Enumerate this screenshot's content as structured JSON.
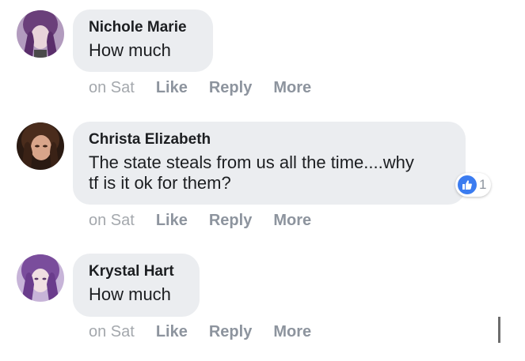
{
  "comments": [
    {
      "author": "Nichole Marie",
      "text": "How much",
      "time": "on Sat",
      "like_label": "Like",
      "reply_label": "Reply",
      "more_label": "More"
    },
    {
      "author": "Christa Elizabeth",
      "text": "The state steals from us all the time....why\ntf is it ok for them?",
      "time": "on Sat",
      "like_label": "Like",
      "reply_label": "Reply",
      "more_label": "More",
      "reactions": {
        "icon": "thumbs-up-icon",
        "count": "1",
        "color": "#3b7cf0"
      }
    },
    {
      "author": "Krystal Hart",
      "text": "How much",
      "time": "on Sat",
      "like_label": "Like",
      "reply_label": "Reply",
      "more_label": "More"
    }
  ],
  "colors": {
    "bubble": "#ebedf0",
    "meta": "#8d949e",
    "accent": "#3b7cf0"
  }
}
